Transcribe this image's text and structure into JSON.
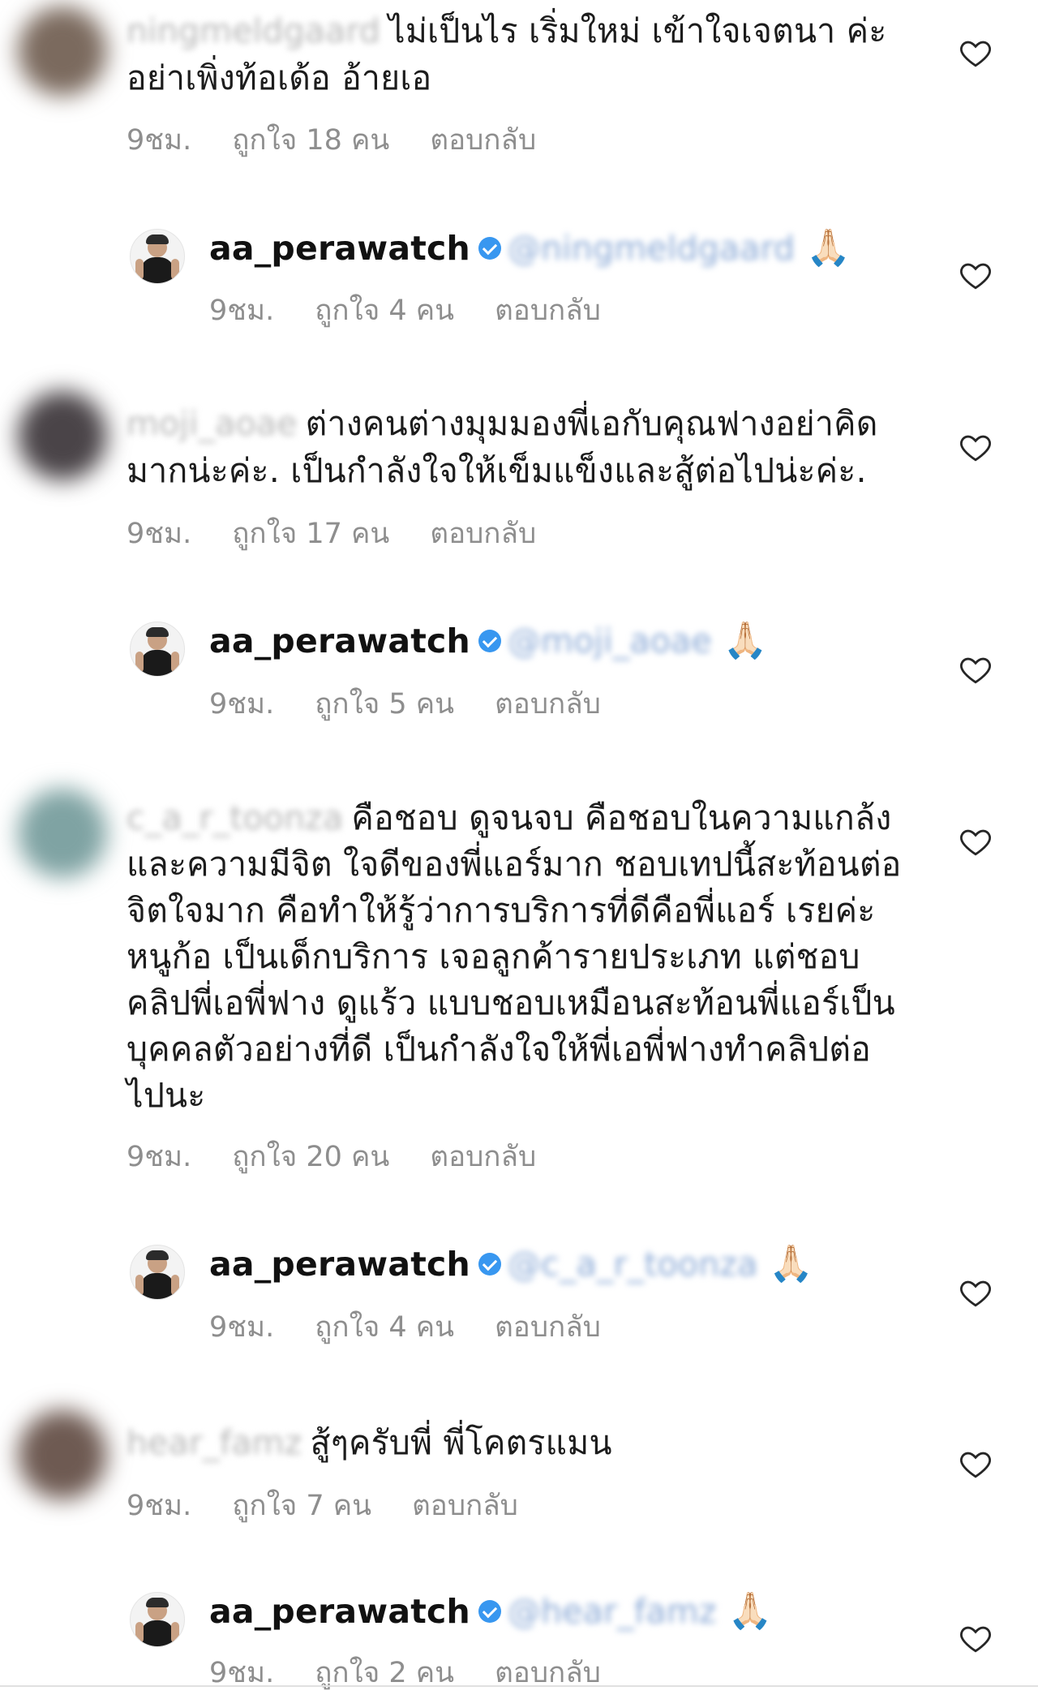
{
  "comments": [
    {
      "user": "ningmeldgaard",
      "text": "ไม่เป็นไร เริ่มใหม่ เข้าใจเจตนา ค่ะ",
      "text2": "อย่าเพิ่งท้อเด้อ อ้ายเอ",
      "time": "9ชม.",
      "likes": "ถูกใจ 18 คน",
      "reply": "ตอบกลับ",
      "avatar_color": "#7b6a5e"
    },
    {
      "user": "aa_perawatch",
      "mention": "@ningmeldgaard",
      "emoji": "🙏🏻",
      "time": "9ชม.",
      "likes": "ถูกใจ 4 คน",
      "reply": "ตอบกลับ"
    },
    {
      "user": "moji_aoae",
      "text": "ต่างคนต่างมุมมองพี่เอกับคุณฟางอย่าคิด",
      "text2": "มากน่ะค่ะ. เป็นกำลังใจให้เข็มแข็งและสู้ต่อไปน่ะค่ะ.",
      "time": "9ชม.",
      "likes": "ถูกใจ 17 คน",
      "reply": "ตอบกลับ",
      "avatar_color": "#4a4448"
    },
    {
      "user": "aa_perawatch",
      "mention": "@moji_aoae",
      "emoji": "🙏🏻",
      "time": "9ชม.",
      "likes": "ถูกใจ 5 คน",
      "reply": "ตอบกลับ"
    },
    {
      "user": "c_a_r_toonza",
      "lines": [
        "คือชอบ ดูจนจบ คือชอบในความแกล้ง",
        "และความมีจิต ใจดีของพี่แอร์มาก ชอบเทปนี้สะท้อนต่อ",
        "จิตใจมาก คือทำให้รู้ว่าการบริการที่ดีคือพี่แอร์ เรยค่ะ",
        "หนูก้อ เป็นเด็กบริการ เจอลูกค้ารายประเภท แต่ชอบ",
        "คลิปพี่เอพี่ฟาง ดูแร้ว แบบชอบเหมือนสะท้อนพี่แอร์เป็น",
        "บุคคลตัวอย่างที่ดี เป็นกำลังใจให้พี่เอพี่ฟางทำคลิปต่อ",
        "ไปนะ"
      ],
      "time": "9ชม.",
      "likes": "ถูกใจ 20 คน",
      "reply": "ตอบกลับ",
      "avatar_color": "#7fa3a3"
    },
    {
      "user": "aa_perawatch",
      "mention": "@c_a_r_toonza",
      "emoji": "🙏🏻",
      "time": "9ชม.",
      "likes": "ถูกใจ 4 คน",
      "reply": "ตอบกลับ"
    },
    {
      "user": "hear_famz",
      "text": "สู้ๆครับพี่ พี่โคตรแมน",
      "time": "9ชม.",
      "likes": "ถูกใจ 7 คน",
      "reply": "ตอบกลับ",
      "avatar_color": "#6e5a52"
    },
    {
      "user": "aa_perawatch",
      "mention": "@hear_famz",
      "emoji": "🙏🏻",
      "time": "9ชม.",
      "likes": "ถูกใจ 2 คน",
      "reply": "ตอบกลับ"
    }
  ],
  "icons": {
    "like": "heart-outline-icon",
    "verified": "verified-badge-icon"
  },
  "colors": {
    "meta": "#8e8e8e",
    "verified": "#3897f0",
    "text": "#1c1c1c"
  }
}
